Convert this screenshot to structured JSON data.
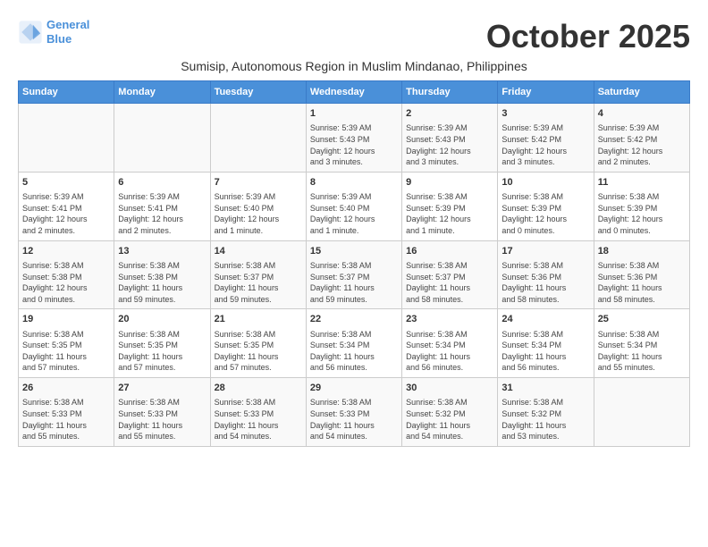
{
  "logo": {
    "line1": "General",
    "line2": "Blue"
  },
  "title": "October 2025",
  "subtitle": "Sumisip, Autonomous Region in Muslim Mindanao, Philippines",
  "days_of_week": [
    "Sunday",
    "Monday",
    "Tuesday",
    "Wednesday",
    "Thursday",
    "Friday",
    "Saturday"
  ],
  "weeks": [
    [
      {
        "day": "",
        "info": ""
      },
      {
        "day": "",
        "info": ""
      },
      {
        "day": "",
        "info": ""
      },
      {
        "day": "1",
        "info": "Sunrise: 5:39 AM\nSunset: 5:43 PM\nDaylight: 12 hours\nand 3 minutes."
      },
      {
        "day": "2",
        "info": "Sunrise: 5:39 AM\nSunset: 5:43 PM\nDaylight: 12 hours\nand 3 minutes."
      },
      {
        "day": "3",
        "info": "Sunrise: 5:39 AM\nSunset: 5:42 PM\nDaylight: 12 hours\nand 3 minutes."
      },
      {
        "day": "4",
        "info": "Sunrise: 5:39 AM\nSunset: 5:42 PM\nDaylight: 12 hours\nand 2 minutes."
      }
    ],
    [
      {
        "day": "5",
        "info": "Sunrise: 5:39 AM\nSunset: 5:41 PM\nDaylight: 12 hours\nand 2 minutes."
      },
      {
        "day": "6",
        "info": "Sunrise: 5:39 AM\nSunset: 5:41 PM\nDaylight: 12 hours\nand 2 minutes."
      },
      {
        "day": "7",
        "info": "Sunrise: 5:39 AM\nSunset: 5:40 PM\nDaylight: 12 hours\nand 1 minute."
      },
      {
        "day": "8",
        "info": "Sunrise: 5:39 AM\nSunset: 5:40 PM\nDaylight: 12 hours\nand 1 minute."
      },
      {
        "day": "9",
        "info": "Sunrise: 5:38 AM\nSunset: 5:39 PM\nDaylight: 12 hours\nand 1 minute."
      },
      {
        "day": "10",
        "info": "Sunrise: 5:38 AM\nSunset: 5:39 PM\nDaylight: 12 hours\nand 0 minutes."
      },
      {
        "day": "11",
        "info": "Sunrise: 5:38 AM\nSunset: 5:39 PM\nDaylight: 12 hours\nand 0 minutes."
      }
    ],
    [
      {
        "day": "12",
        "info": "Sunrise: 5:38 AM\nSunset: 5:38 PM\nDaylight: 12 hours\nand 0 minutes."
      },
      {
        "day": "13",
        "info": "Sunrise: 5:38 AM\nSunset: 5:38 PM\nDaylight: 11 hours\nand 59 minutes."
      },
      {
        "day": "14",
        "info": "Sunrise: 5:38 AM\nSunset: 5:37 PM\nDaylight: 11 hours\nand 59 minutes."
      },
      {
        "day": "15",
        "info": "Sunrise: 5:38 AM\nSunset: 5:37 PM\nDaylight: 11 hours\nand 59 minutes."
      },
      {
        "day": "16",
        "info": "Sunrise: 5:38 AM\nSunset: 5:37 PM\nDaylight: 11 hours\nand 58 minutes."
      },
      {
        "day": "17",
        "info": "Sunrise: 5:38 AM\nSunset: 5:36 PM\nDaylight: 11 hours\nand 58 minutes."
      },
      {
        "day": "18",
        "info": "Sunrise: 5:38 AM\nSunset: 5:36 PM\nDaylight: 11 hours\nand 58 minutes."
      }
    ],
    [
      {
        "day": "19",
        "info": "Sunrise: 5:38 AM\nSunset: 5:35 PM\nDaylight: 11 hours\nand 57 minutes."
      },
      {
        "day": "20",
        "info": "Sunrise: 5:38 AM\nSunset: 5:35 PM\nDaylight: 11 hours\nand 57 minutes."
      },
      {
        "day": "21",
        "info": "Sunrise: 5:38 AM\nSunset: 5:35 PM\nDaylight: 11 hours\nand 57 minutes."
      },
      {
        "day": "22",
        "info": "Sunrise: 5:38 AM\nSunset: 5:34 PM\nDaylight: 11 hours\nand 56 minutes."
      },
      {
        "day": "23",
        "info": "Sunrise: 5:38 AM\nSunset: 5:34 PM\nDaylight: 11 hours\nand 56 minutes."
      },
      {
        "day": "24",
        "info": "Sunrise: 5:38 AM\nSunset: 5:34 PM\nDaylight: 11 hours\nand 56 minutes."
      },
      {
        "day": "25",
        "info": "Sunrise: 5:38 AM\nSunset: 5:34 PM\nDaylight: 11 hours\nand 55 minutes."
      }
    ],
    [
      {
        "day": "26",
        "info": "Sunrise: 5:38 AM\nSunset: 5:33 PM\nDaylight: 11 hours\nand 55 minutes."
      },
      {
        "day": "27",
        "info": "Sunrise: 5:38 AM\nSunset: 5:33 PM\nDaylight: 11 hours\nand 55 minutes."
      },
      {
        "day": "28",
        "info": "Sunrise: 5:38 AM\nSunset: 5:33 PM\nDaylight: 11 hours\nand 54 minutes."
      },
      {
        "day": "29",
        "info": "Sunrise: 5:38 AM\nSunset: 5:33 PM\nDaylight: 11 hours\nand 54 minutes."
      },
      {
        "day": "30",
        "info": "Sunrise: 5:38 AM\nSunset: 5:32 PM\nDaylight: 11 hours\nand 54 minutes."
      },
      {
        "day": "31",
        "info": "Sunrise: 5:38 AM\nSunset: 5:32 PM\nDaylight: 11 hours\nand 53 minutes."
      },
      {
        "day": "",
        "info": ""
      }
    ]
  ]
}
